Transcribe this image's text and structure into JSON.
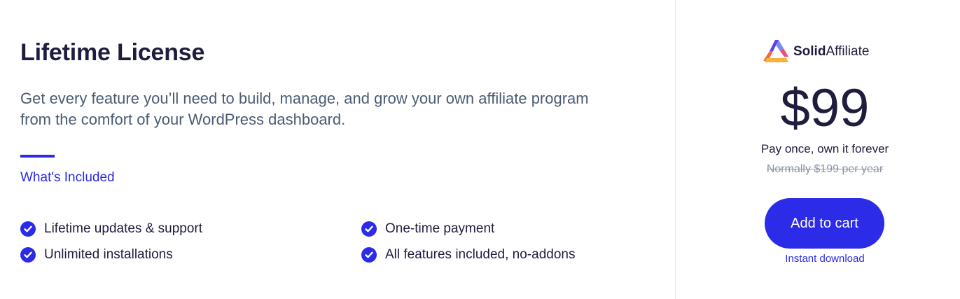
{
  "left": {
    "title": "Lifetime License",
    "description": "Get every feature you’ll need to build, manage, and grow your own affiliate program from the comfort of your WordPress dashboard.",
    "included_label": "What's Included",
    "features": [
      {
        "label": "Lifetime updates & support",
        "icon": "check-circle-icon"
      },
      {
        "label": "Unlimited installations",
        "icon": "check-circle-icon"
      },
      {
        "label": "One-time payment",
        "icon": "check-circle-icon"
      },
      {
        "label": "All features included, no-addons",
        "icon": "check-circle-icon"
      }
    ]
  },
  "right": {
    "logo": {
      "bold": "Solid",
      "light": "Affiliate"
    },
    "price": "$99",
    "pay_once": "Pay once, own it forever",
    "normally": "Normally $199 per year",
    "cart_button": "Add to cart",
    "instant_download": "Instant download"
  },
  "colors": {
    "accent": "#2b2be8",
    "heading": "#1f1d3d",
    "body_text": "#4b5b73",
    "muted": "#8a94a3",
    "divider": "#e5e7eb"
  }
}
